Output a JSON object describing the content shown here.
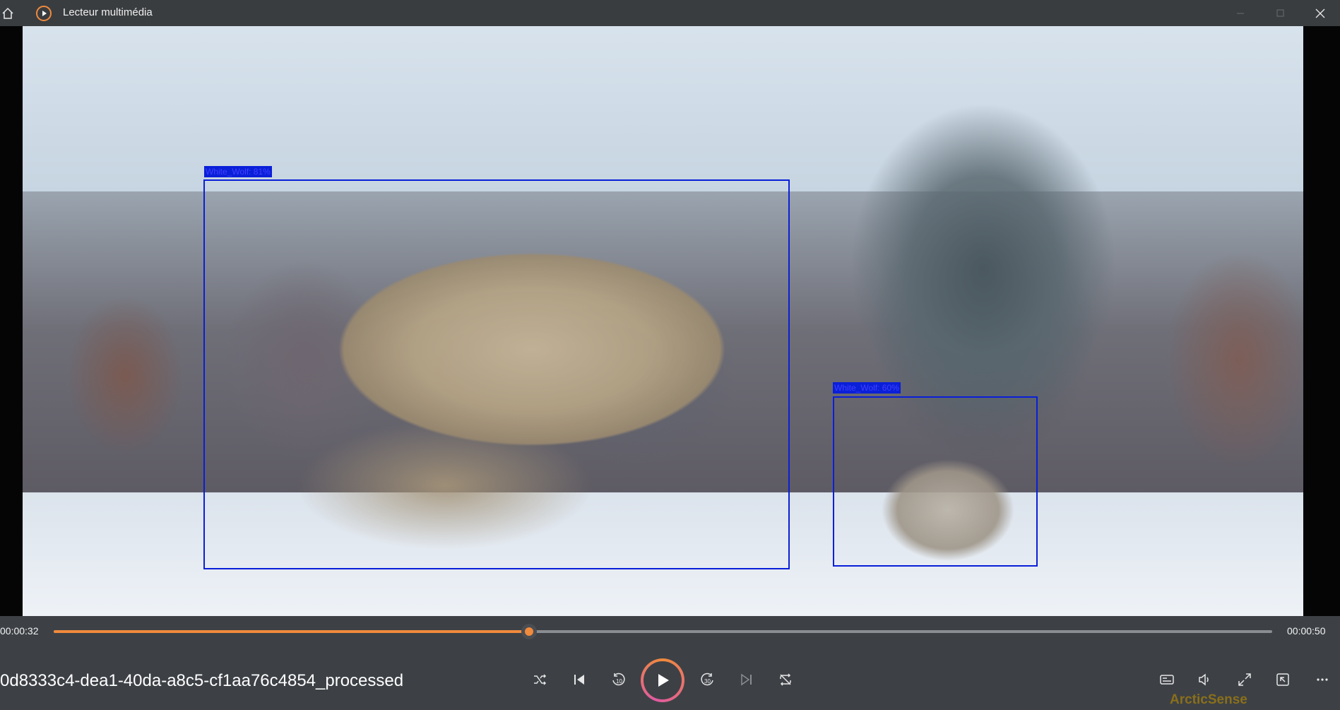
{
  "app": {
    "title": "Lecteur multimédia",
    "accent_color": "#f08a3c"
  },
  "titlebar": {
    "icons": [
      "home-icon",
      "app-play-icon",
      "minimize-icon",
      "maximize-icon",
      "close-icon"
    ]
  },
  "video": {
    "detections": [
      {
        "label": "White_Wolf: 81%"
      },
      {
        "label": "White_Wolf: 60%"
      }
    ],
    "bbox_color": "#0a1fd8"
  },
  "playback": {
    "current_time": "00:00:32",
    "total_time": "00:00:50",
    "progress_fraction": 0.39,
    "file_name": "0d8333c4-dea1-40da-a8c5-cf1aa76c4854_processed"
  },
  "controls": {
    "icons": [
      "shuffle-icon",
      "previous-icon",
      "rewind-10-icon",
      "play-icon",
      "forward-30-icon",
      "next-icon",
      "repeat-icon",
      "subtitles-icon",
      "volume-icon",
      "fullscreen-icon",
      "mini-player-icon",
      "more-icon"
    ],
    "rewind_label": "10",
    "forward_label": "30"
  },
  "watermark": "ArcticSense"
}
